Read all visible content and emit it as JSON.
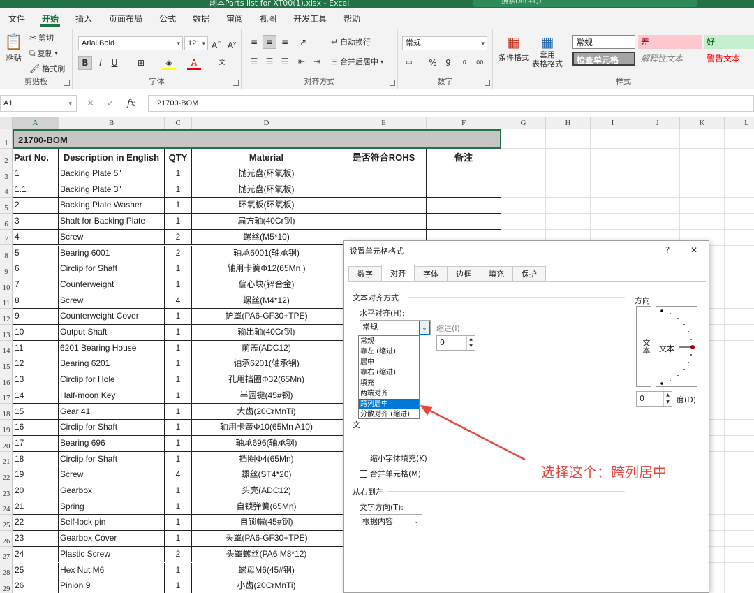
{
  "window": {
    "title": "副本Parts list for XT00(1).xlsx  -  Excel",
    "search_placeholder": "搜索(Alt+Q)"
  },
  "ribbon_tabs": [
    "文件",
    "开始",
    "插入",
    "页面布局",
    "公式",
    "数据",
    "审阅",
    "视图",
    "开发工具",
    "帮助"
  ],
  "ribbon": {
    "clipboard": {
      "paste": "粘贴",
      "cut": "剪切",
      "copy": "复制",
      "format_painter": "格式刷",
      "label": "剪贴板"
    },
    "font": {
      "name": "Arial Bold",
      "size": "12",
      "bold": "B",
      "italic": "I",
      "underline": "U",
      "label": "字体"
    },
    "alignment": {
      "wrap": "自动换行",
      "merge": "合并后居中",
      "label": "对齐方式"
    },
    "number": {
      "format": "常规",
      "percent": "%",
      "comma": "9",
      "label": "数字"
    },
    "styles": {
      "conditional": "条件格式",
      "table_format": "套用\n表格格式",
      "normal": "常规",
      "bad": "差",
      "good": "好",
      "check": "检查单元格",
      "explanatory": "解释性文本",
      "warning": "警告文本",
      "label": "样式"
    }
  },
  "formula_bar": {
    "name_box": "A1",
    "fx": "fx",
    "content": "21700-BOM"
  },
  "columns": [
    "A",
    "B",
    "C",
    "D",
    "E",
    "F",
    "G",
    "H",
    "I",
    "J",
    "K",
    "L"
  ],
  "sheet": {
    "title": "21700-BOM",
    "headers": [
      "Part No.",
      "Description in English",
      "QTY",
      "Material",
      "是否符合ROHS",
      "备注"
    ],
    "rows": [
      [
        "1",
        "Backing Plate 5\"",
        "1",
        "抛光盘(环氧板)"
      ],
      [
        "1.1",
        "Backing Plate 3\"",
        "1",
        "抛光盘(环氧板)"
      ],
      [
        "2",
        "Backing Plate Washer",
        "1",
        "环氧板(环氧板)"
      ],
      [
        "3",
        "Shaft for Backing Plate",
        "1",
        "扁方轴(40Cr钢)"
      ],
      [
        "4",
        "Screw",
        "2",
        "螺丝(M5*10)"
      ],
      [
        "5",
        "Bearing 6001",
        "2",
        "轴承6001(轴承钢)"
      ],
      [
        "6",
        "Circlip for Shaft",
        "1",
        "轴用卡簧Φ12(65Mn )"
      ],
      [
        "7",
        "Counterweight",
        "1",
        "偏心块(锌合金)"
      ],
      [
        "8",
        "Screw",
        "4",
        "螺丝(M4*12)"
      ],
      [
        "9",
        "Counterweight Cover",
        "1",
        "护罩(PA6-GF30+TPE)"
      ],
      [
        "10",
        "Output Shaft",
        "1",
        "输出轴(40Cr钢)"
      ],
      [
        "11",
        "6201 Bearing House",
        "1",
        "前盖(ADC12)"
      ],
      [
        "12",
        "Bearing 6201",
        "1",
        "轴承6201(轴承钢)"
      ],
      [
        "13",
        "Circlip for Hole",
        "1",
        "孔用挡圈Φ32(65Mn)"
      ],
      [
        "14",
        "Half-moon Key",
        "1",
        "半圆键(45#钢)"
      ],
      [
        "15",
        "Gear 41",
        "1",
        "大齿(20CrMnTi)"
      ],
      [
        "16",
        "Circlip for Shaft",
        "1",
        "轴用卡簧Φ10(65Mn  A10)"
      ],
      [
        "17",
        "Bearing 696",
        "1",
        "轴承696(轴承钢)"
      ],
      [
        "18",
        "Circlip for Shaft",
        "1",
        "挡圈Φ4(65Mn)"
      ],
      [
        "19",
        "Screw",
        "4",
        "螺丝(ST4*20)"
      ],
      [
        "20",
        "Gearbox",
        "1",
        "头壳(ADC12)"
      ],
      [
        "21",
        "Spring",
        "1",
        "自锁弹簧(65Mn)"
      ],
      [
        "22",
        "Self-lock pin",
        "1",
        "自锁帽(45#钢)"
      ],
      [
        "23",
        "Gearbox Cover",
        "1",
        "头罩(PA6-GF30+TPE)"
      ],
      [
        "24",
        "Plastic Screw",
        "2",
        "头罩螺丝(PA6 M8*12)"
      ],
      [
        "25",
        "Hex Nut M6",
        "1",
        "螺母M6(45#钢)"
      ],
      [
        "26",
        "Pinion 9",
        "1",
        "小齿(20CrMnTi)"
      ]
    ]
  },
  "dialog": {
    "title": "设置单元格格式",
    "help": "?",
    "close": "✕",
    "tabs": [
      "数字",
      "对齐",
      "字体",
      "边框",
      "填充",
      "保护"
    ],
    "active_tab": "对齐",
    "text_align_section": "文本对齐方式",
    "horizontal_label": "水平对齐(H):",
    "horizontal_value": "常规",
    "indent_label": "缩进(I):",
    "indent_value": "0",
    "dropdown_options": [
      "常规",
      "靠左 (缩进)",
      "居中",
      "靠右 (缩进)",
      "填充",
      "两端对齐",
      "跨列居中",
      "分散对齐 (缩进)"
    ],
    "selected_option": "跨列居中",
    "shrink_label": "缩小字体填充(K)",
    "merge_label": "合并单元格(M)",
    "rtl_section": "从右到左",
    "direction_label": "文字方向(T):",
    "direction_value": "根据内容",
    "orientation_section": "方向",
    "vertical_text": "文本",
    "dial_text": "文本",
    "degree_value": "0",
    "degree_label": "度(D)",
    "cut_char": "文"
  },
  "annotation": {
    "text": "选择这个：跨列居中",
    "color": "#e8473e"
  }
}
